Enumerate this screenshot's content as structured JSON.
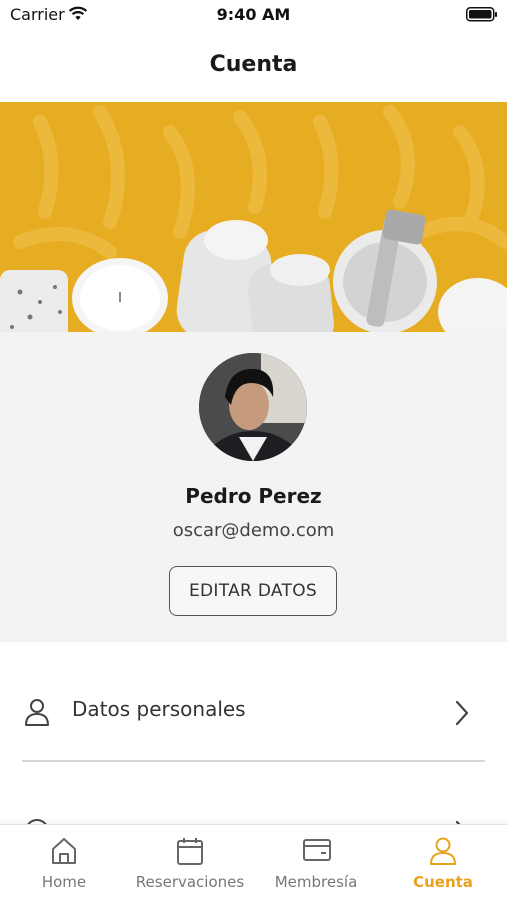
{
  "status_bar": {
    "carrier": "Carrier",
    "time": "9:40 AM"
  },
  "header": {
    "title": "Cuenta"
  },
  "profile": {
    "name": "Pedro Perez",
    "email": "oscar@demo.com",
    "edit_button": "EDITAR DATOS"
  },
  "menu": {
    "items": [
      {
        "label": "Datos personales",
        "icon": "user-icon"
      },
      {
        "label": "",
        "icon": "circle-icon"
      }
    ]
  },
  "tab_bar": {
    "items": [
      {
        "label": "Home",
        "icon": "home-icon",
        "active": false
      },
      {
        "label": "Reservaciones",
        "icon": "calendar-icon",
        "active": false
      },
      {
        "label": "Membresía",
        "icon": "card-icon",
        "active": false
      },
      {
        "label": "Cuenta",
        "icon": "user-icon",
        "active": true
      }
    ]
  },
  "colors": {
    "accent": "#e9a21a",
    "banner": "#e7ad22",
    "profile_bg": "#f3f3f3"
  }
}
